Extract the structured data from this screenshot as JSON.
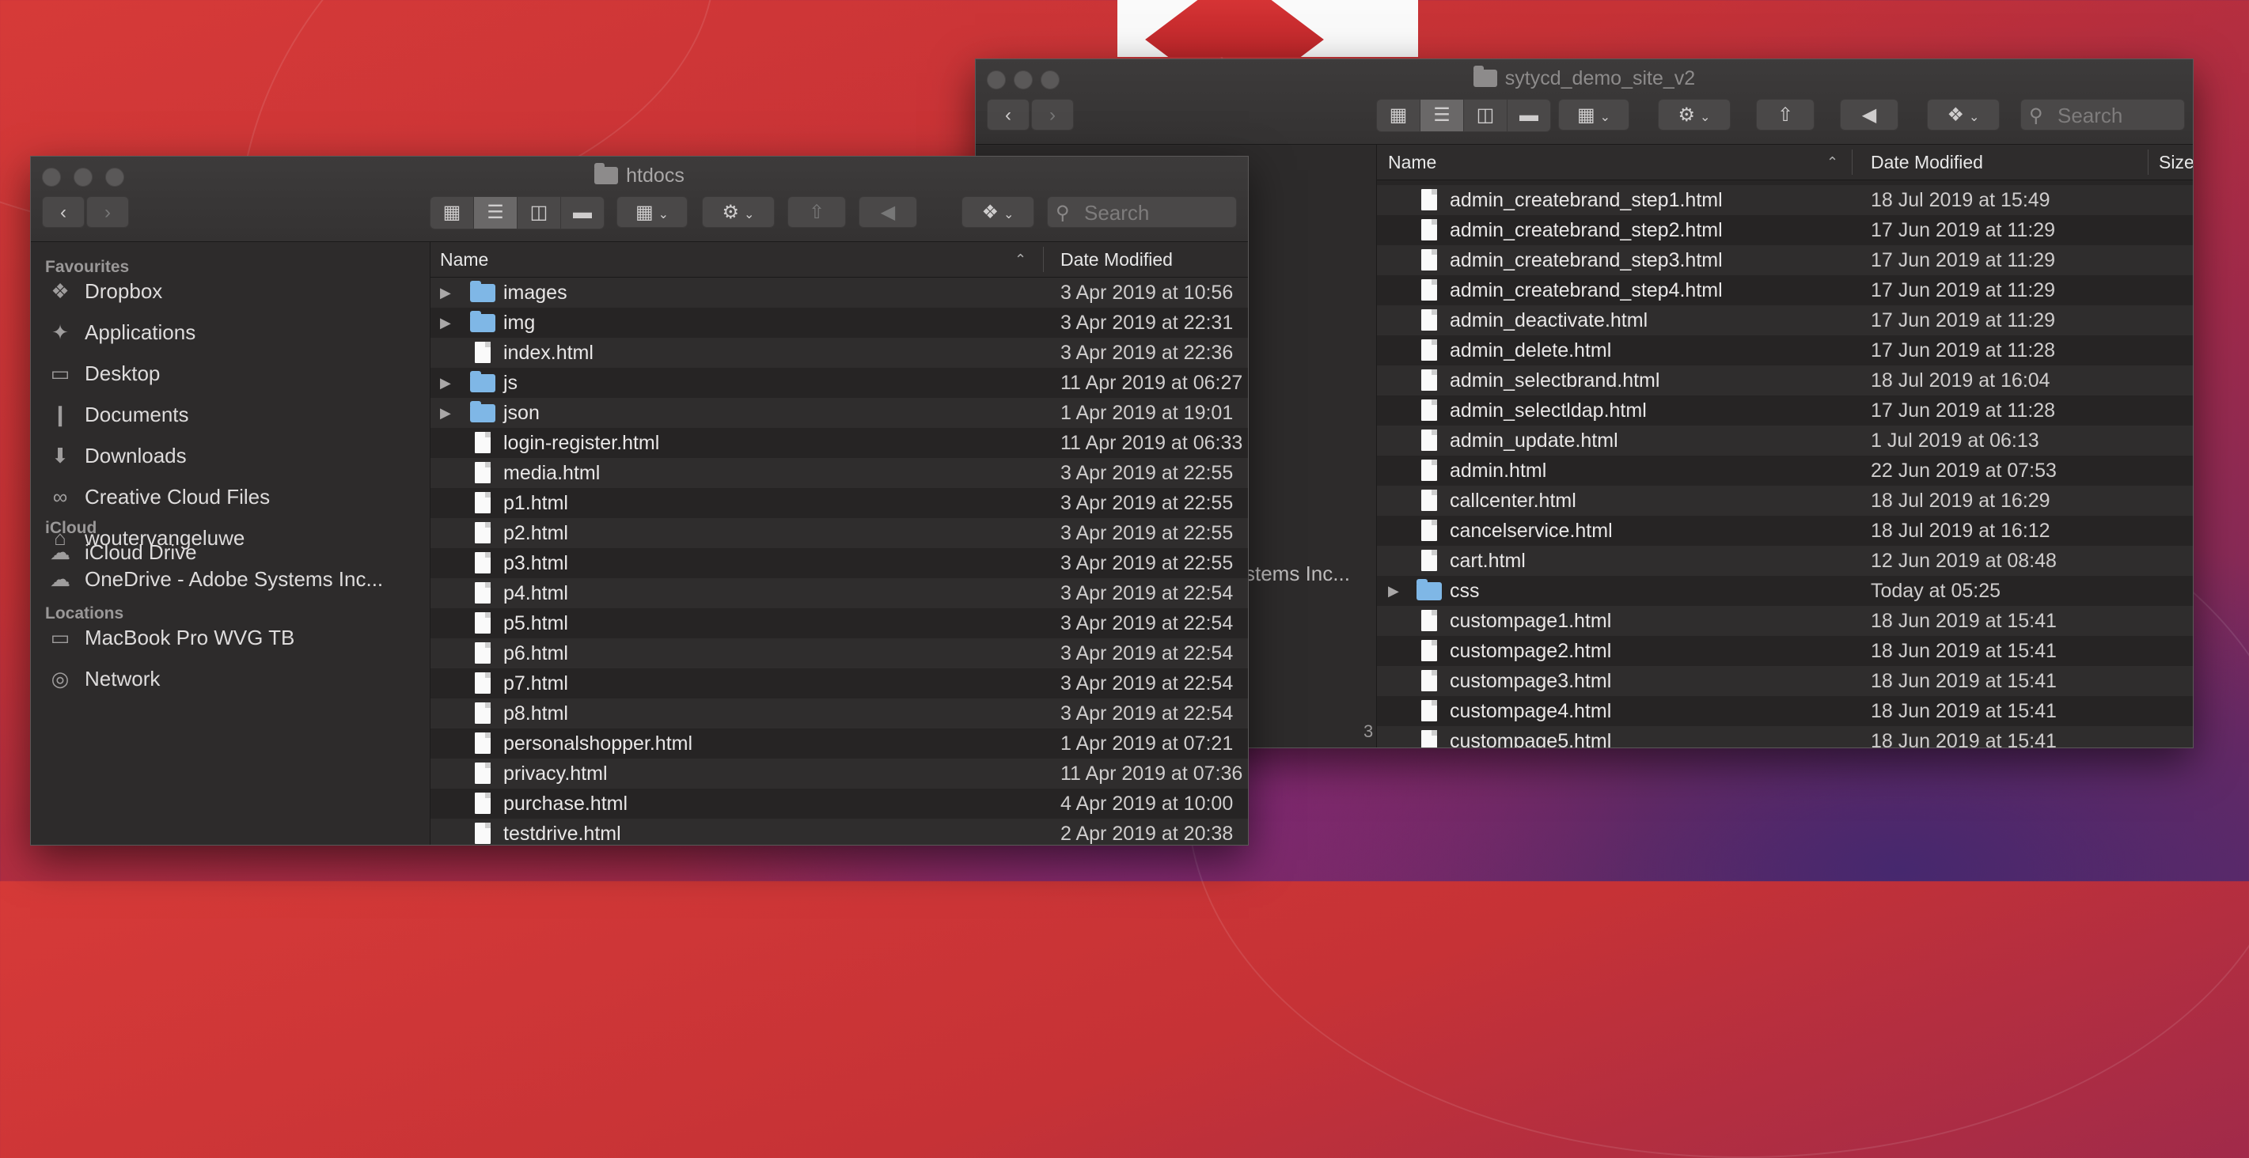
{
  "left_window": {
    "title": "htdocs",
    "search_placeholder": "Search",
    "sidebar": {
      "favourites_header": "Favourites",
      "favourites": [
        {
          "label": "Dropbox",
          "icon": "dropbox-icon"
        },
        {
          "label": "Applications",
          "icon": "applications-icon"
        },
        {
          "label": "Desktop",
          "icon": "desktop-icon"
        },
        {
          "label": "Documents",
          "icon": "documents-icon"
        },
        {
          "label": "Downloads",
          "icon": "downloads-icon"
        },
        {
          "label": "Creative Cloud Files",
          "icon": "creative-cloud-icon"
        },
        {
          "label": "woutervangeluwe",
          "icon": "home-icon"
        },
        {
          "label": "OneDrive - Adobe Systems Inc...",
          "icon": "cloud-icon"
        }
      ],
      "icloud_header": "iCloud",
      "icloud": [
        {
          "label": "iCloud Drive",
          "icon": "icloud-icon"
        }
      ],
      "locations_header": "Locations",
      "locations": [
        {
          "label": "MacBook Pro WVG TB",
          "icon": "laptop-icon"
        },
        {
          "label": "Network",
          "icon": "network-icon"
        }
      ]
    },
    "columns": {
      "name": "Name",
      "date": "Date Modified"
    },
    "files": [
      {
        "name": "images",
        "date": "3 Apr 2019 at 10:56",
        "folder": true
      },
      {
        "name": "img",
        "date": "3 Apr 2019 at 22:31",
        "folder": true
      },
      {
        "name": "index.html",
        "date": "3 Apr 2019 at 22:36",
        "folder": false
      },
      {
        "name": "js",
        "date": "11 Apr 2019 at 06:27",
        "folder": true
      },
      {
        "name": "json",
        "date": "1 Apr 2019 at 19:01",
        "folder": true
      },
      {
        "name": "login-register.html",
        "date": "11 Apr 2019 at 06:33",
        "folder": false
      },
      {
        "name": "media.html",
        "date": "3 Apr 2019 at 22:55",
        "folder": false
      },
      {
        "name": "p1.html",
        "date": "3 Apr 2019 at 22:55",
        "folder": false
      },
      {
        "name": "p2.html",
        "date": "3 Apr 2019 at 22:55",
        "folder": false
      },
      {
        "name": "p3.html",
        "date": "3 Apr 2019 at 22:55",
        "folder": false
      },
      {
        "name": "p4.html",
        "date": "3 Apr 2019 at 22:54",
        "folder": false
      },
      {
        "name": "p5.html",
        "date": "3 Apr 2019 at 22:54",
        "folder": false
      },
      {
        "name": "p6.html",
        "date": "3 Apr 2019 at 22:54",
        "folder": false
      },
      {
        "name": "p7.html",
        "date": "3 Apr 2019 at 22:54",
        "folder": false
      },
      {
        "name": "p8.html",
        "date": "3 Apr 2019 at 22:54",
        "folder": false
      },
      {
        "name": "personalshopper.html",
        "date": "1 Apr 2019 at 07:21",
        "folder": false
      },
      {
        "name": "privacy.html",
        "date": "11 Apr 2019 at 07:36",
        "folder": false
      },
      {
        "name": "purchase.html",
        "date": "4 Apr 2019 at 10:00",
        "folder": false
      },
      {
        "name": "testdrive.html",
        "date": "2 Apr 2019 at 20:38",
        "folder": false
      }
    ]
  },
  "right_window": {
    "title": "sytycd_demo_site_v2",
    "search_placeholder": "Search",
    "sidebar_peek": "stems Inc...",
    "sidebar_peek2": "3",
    "columns": {
      "name": "Name",
      "date": "Date Modified",
      "size": "Size"
    },
    "files": [
      {
        "name": "admin_createbrand_step1.html",
        "date": "18 Jul 2019 at 15:49",
        "folder": false
      },
      {
        "name": "admin_createbrand_step2.html",
        "date": "17 Jun 2019 at 11:29",
        "folder": false
      },
      {
        "name": "admin_createbrand_step3.html",
        "date": "17 Jun 2019 at 11:29",
        "folder": false
      },
      {
        "name": "admin_createbrand_step4.html",
        "date": "17 Jun 2019 at 11:29",
        "folder": false
      },
      {
        "name": "admin_deactivate.html",
        "date": "17 Jun 2019 at 11:29",
        "folder": false
      },
      {
        "name": "admin_delete.html",
        "date": "17 Jun 2019 at 11:28",
        "folder": false
      },
      {
        "name": "admin_selectbrand.html",
        "date": "18 Jul 2019 at 16:04",
        "folder": false
      },
      {
        "name": "admin_selectldap.html",
        "date": "17 Jun 2019 at 11:28",
        "folder": false
      },
      {
        "name": "admin_update.html",
        "date": "1 Jul 2019 at 06:13",
        "folder": false
      },
      {
        "name": "admin.html",
        "date": "22 Jun 2019 at 07:53",
        "folder": false
      },
      {
        "name": "callcenter.html",
        "date": "18 Jul 2019 at 16:29",
        "folder": false
      },
      {
        "name": "cancelservice.html",
        "date": "18 Jul 2019 at 16:12",
        "folder": false
      },
      {
        "name": "cart.html",
        "date": "12 Jun 2019 at 08:48",
        "folder": false
      },
      {
        "name": "css",
        "date": "Today at 05:25",
        "folder": true
      },
      {
        "name": "custompage1.html",
        "date": "18 Jun 2019 at 15:41",
        "folder": false
      },
      {
        "name": "custompage2.html",
        "date": "18 Jun 2019 at 15:41",
        "folder": false
      },
      {
        "name": "custompage3.html",
        "date": "18 Jun 2019 at 15:41",
        "folder": false
      },
      {
        "name": "custompage4.html",
        "date": "18 Jun 2019 at 15:41",
        "folder": false
      },
      {
        "name": "custompage5.html",
        "date": "18 Jun 2019 at 15:41",
        "folder": false
      }
    ]
  }
}
